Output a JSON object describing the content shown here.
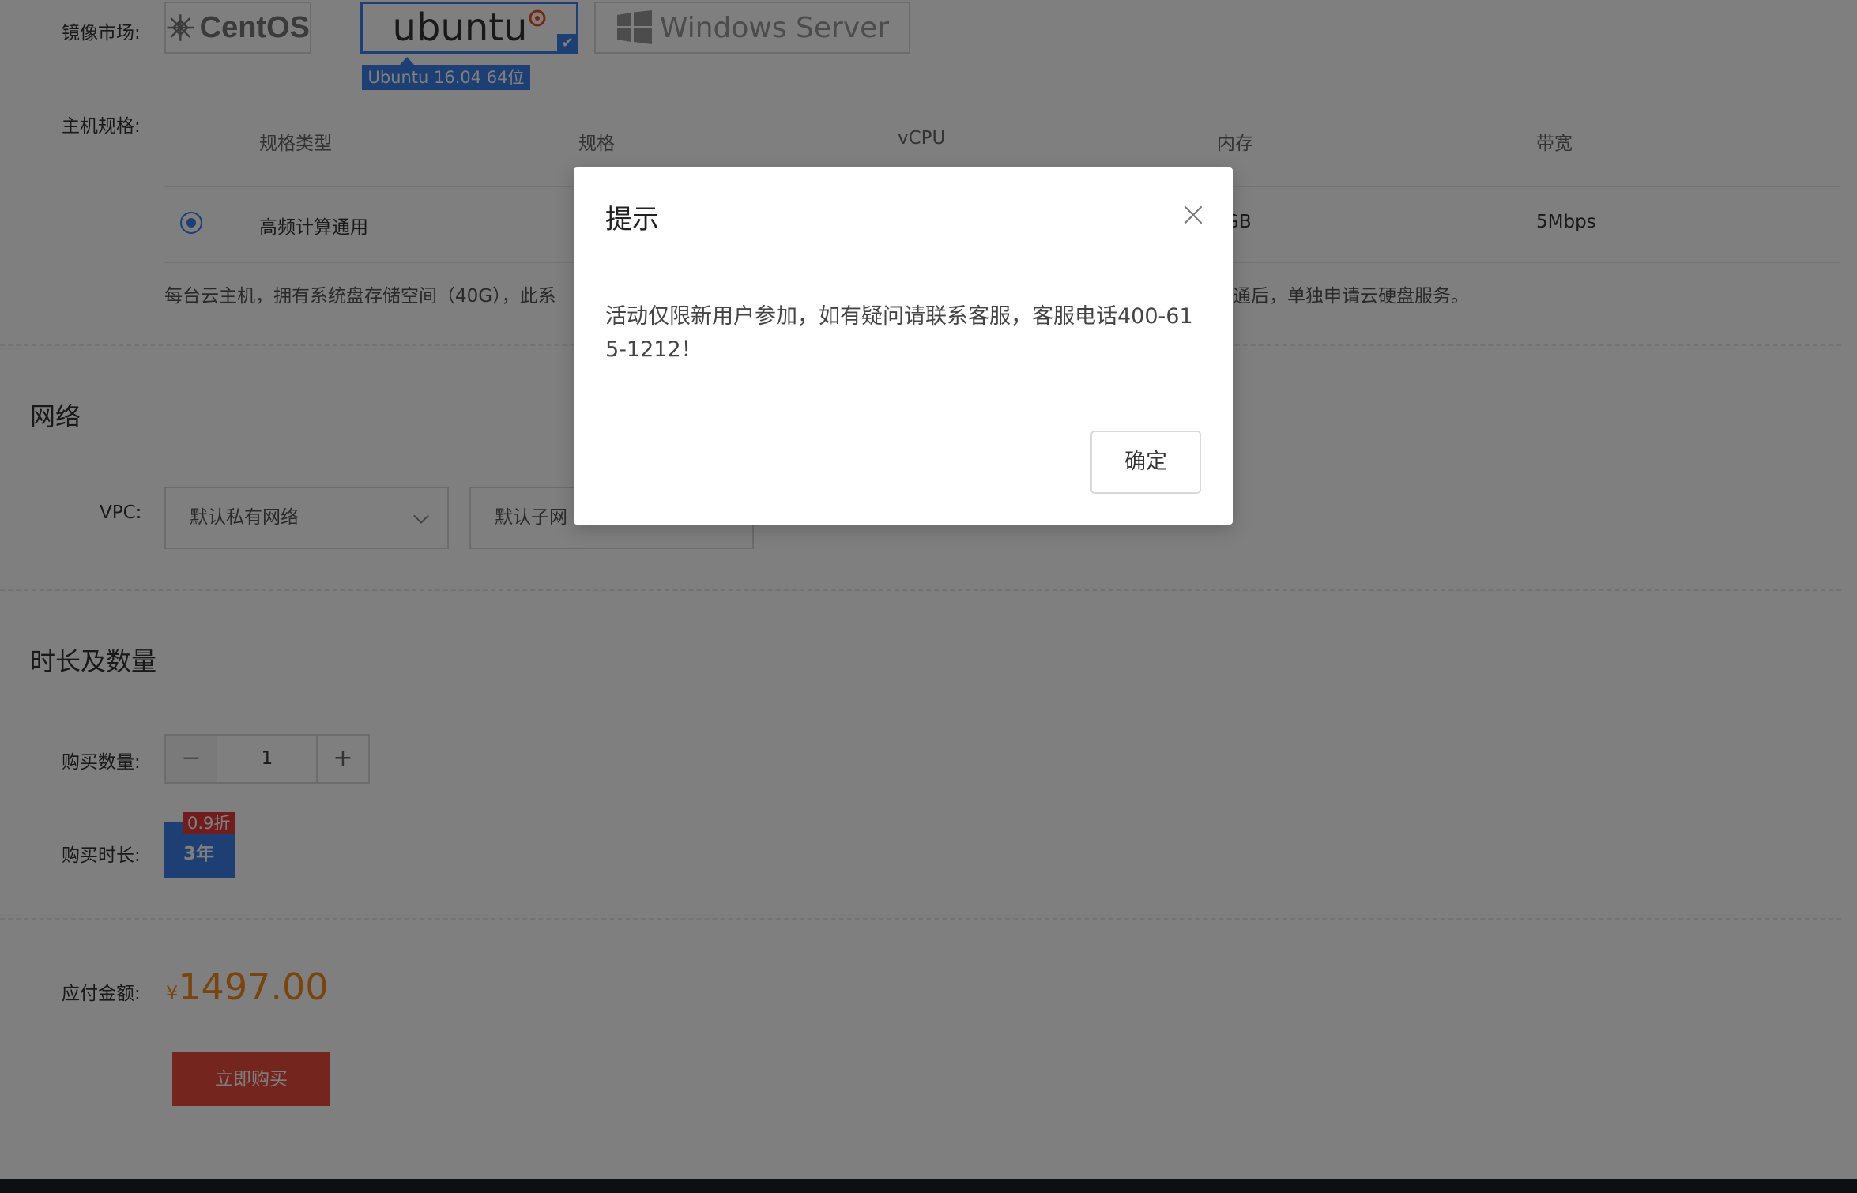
{
  "image_market": {
    "label": "镜像市场:",
    "options": [
      {
        "name": "CentOS",
        "selected": false
      },
      {
        "name": "ubuntu",
        "selected": true
      },
      {
        "name": "Windows Server",
        "selected": false
      }
    ],
    "selected_version": "Ubuntu 16.04 64位"
  },
  "host_spec": {
    "label": "主机规格:",
    "headers": [
      "规格类型",
      "规格",
      "vCPU",
      "内存",
      "带宽"
    ],
    "row": {
      "type": "高频计算通用",
      "memory_fragment": "GB",
      "bandwidth": "5Mbps"
    },
    "note_left": "每台云主机，拥有系统盘存储空间（40G），此系",
    "note_right": "通后，单独申请云硬盘服务。"
  },
  "network": {
    "title": "网络",
    "vpc_label": "VPC:",
    "vpc_value": "默认私有网络",
    "subnet_value": "默认子网"
  },
  "duration": {
    "title": "时长及数量",
    "qty_label": "购买数量:",
    "qty_minus": "−",
    "qty_value": "1",
    "qty_plus": "+",
    "time_label": "购买时长:",
    "time_value": "3年",
    "discount": "0.9折"
  },
  "payment": {
    "label": "应付金额:",
    "currency": "¥",
    "amount": "1497.00",
    "buy_button": "立即购买"
  },
  "modal": {
    "title": "提示",
    "message": "活动仅限新用户参加，如有疑问请联系客服，客服电话400-615-1212！",
    "ok_button": "确定"
  },
  "colors": {
    "accent": "#3d7ee6",
    "price": "#f08a1c",
    "buy": "#e84c3d",
    "badge": "#e33b3b"
  }
}
